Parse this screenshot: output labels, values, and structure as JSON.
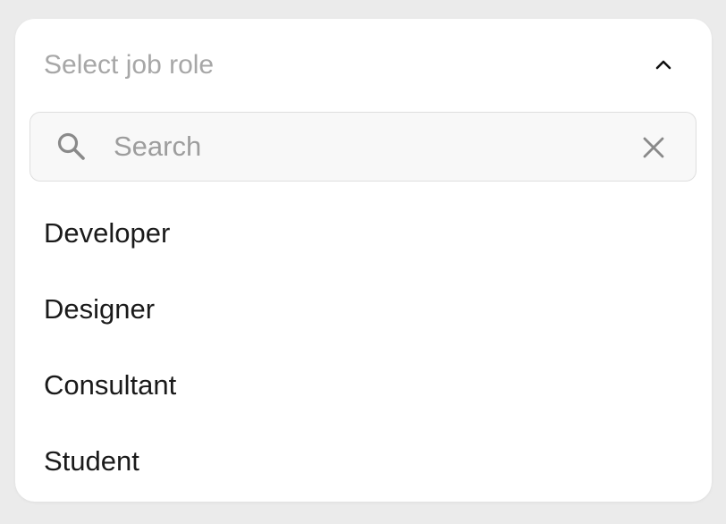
{
  "dropdown": {
    "placeholder": "Select job role",
    "expanded": true,
    "chevron_icon": "chevron-up-icon",
    "search": {
      "placeholder": "Search",
      "value": "",
      "search_icon": "search-icon",
      "clear_icon": "close-icon"
    },
    "options": [
      {
        "label": "Developer"
      },
      {
        "label": "Designer"
      },
      {
        "label": "Consultant"
      },
      {
        "label": "Student"
      }
    ]
  },
  "colors": {
    "background": "#ebebeb",
    "card": "#ffffff",
    "placeholder_text": "#a7a7a7",
    "option_text": "#1a1a1a",
    "search_background": "#f8f8f8",
    "search_border": "#dedede",
    "icon": "#8a8a8a"
  }
}
